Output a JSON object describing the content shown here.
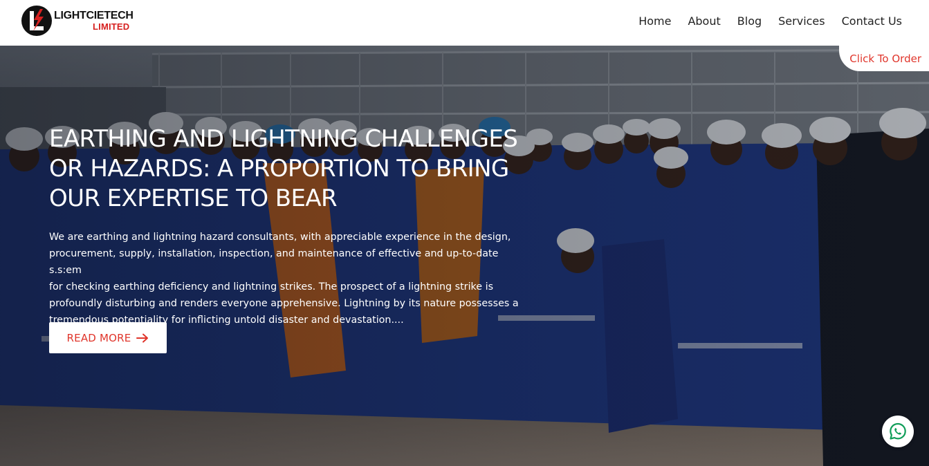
{
  "brand": {
    "name_line1": "LIGHTCIETECH",
    "name_line2": "LIMITED",
    "logo_icon": "lightning-logo-icon",
    "primary_color": "#111111",
    "accent_color": "#d6201f"
  },
  "nav": {
    "items": [
      {
        "label": "Home"
      },
      {
        "label": "About"
      },
      {
        "label": "Blog"
      },
      {
        "label": "Services"
      },
      {
        "label": "Contact Us"
      }
    ]
  },
  "order_tab": {
    "label": "Click To Order",
    "color": "#e0352b"
  },
  "hero": {
    "title_lines": [
      "EARTHING AND LIGHTNING CHALLENGES",
      "OR HAZARDS: A PROPORTION TO BRING",
      "OUR EXPERTISE TO BEAR"
    ],
    "text_lines": [
      "We are earthing and lightning hazard consultants, with appreciable experience in the design,",
      "procurement, supply, installation, inspection, and maintenance of effective and up-to-date s.s:em",
      "for checking earthing deficiency and lightning strikes. The prospect of a lightning strike is",
      "profoundly disturbing and renders everyone apprehensive. Lightning by its nature possesses a",
      "tremendous potentiality for inflicting untold disaster and devastation...."
    ],
    "cta_label": "READ MORE",
    "cta_icon": "arrow-right-icon",
    "background": "group-photo-of-workers-in-blue-coveralls-and-helmets"
  },
  "floating": {
    "whatsapp_icon": "whatsapp-icon",
    "whatsapp_color": "#0f9d58"
  }
}
